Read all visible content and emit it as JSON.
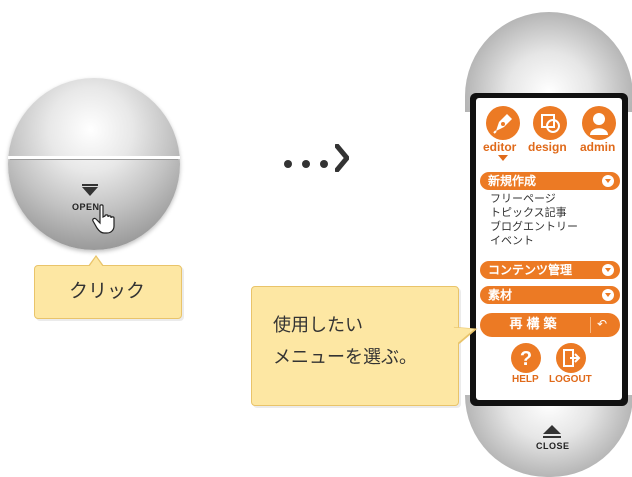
{
  "left": {
    "open_label": "OPEN",
    "callout_text": "クリック"
  },
  "tools": [
    {
      "label": "editor",
      "icon": "pen-icon"
    },
    {
      "label": "design",
      "icon": "design-icon"
    },
    {
      "label": "admin",
      "icon": "user-icon"
    }
  ],
  "sections": [
    {
      "label": "新規作成",
      "items": [
        "フリーページ",
        "トピックス記事",
        "ブログエントリー",
        "イベント"
      ]
    },
    {
      "label": "コンテンツ管理",
      "items": []
    },
    {
      "label": "素材",
      "items": []
    }
  ],
  "rebuild_label": "再構築",
  "footer": {
    "help_label": "HELP",
    "logout_label": "LOGOUT"
  },
  "close_label": "CLOSE",
  "callout_menu": {
    "line1": "使用したい",
    "line2": "メニューを選ぶ。"
  },
  "colors": {
    "accent": "#ec7a24",
    "callout": "#fde7a3"
  }
}
